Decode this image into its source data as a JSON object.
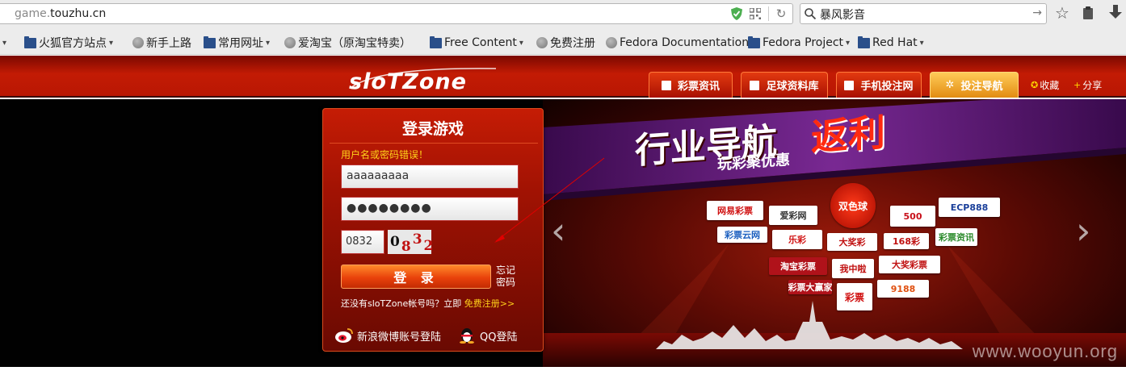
{
  "browser": {
    "url_prefix": "game.",
    "url_domain": "touzhu.cn",
    "search_value": "暴风影音"
  },
  "bookmarks": [
    {
      "label": "火狐官方站点",
      "type": "folder",
      "dropdown": true
    },
    {
      "label": "新手上路",
      "type": "globe",
      "dropdown": false
    },
    {
      "label": "常用网址",
      "type": "folder",
      "dropdown": true
    },
    {
      "label": "爱淘宝（原淘宝特卖）",
      "type": "globe",
      "dropdown": false
    },
    {
      "label": "Free Content",
      "type": "folder",
      "dropdown": true
    },
    {
      "label": "免费注册",
      "type": "globe",
      "dropdown": false
    },
    {
      "label": "Fedora Documentation",
      "type": "globe",
      "dropdown": false
    },
    {
      "label": "Fedora Project",
      "type": "folder",
      "dropdown": true
    },
    {
      "label": "Red Hat",
      "type": "folder",
      "dropdown": true
    }
  ],
  "header": {
    "logo": "sloTZone",
    "nav": [
      {
        "label": "彩票资讯",
        "icon": "list-icon",
        "active": false
      },
      {
        "label": "足球资料库",
        "icon": "doc-icon",
        "active": false
      },
      {
        "label": "手机投注网",
        "icon": "phone-icon",
        "active": false
      },
      {
        "label": "投注导航",
        "icon": "gear-icon",
        "active": true
      }
    ],
    "favorite": "收藏",
    "share": "分享"
  },
  "login": {
    "title": "登录游戏",
    "error": "用户名或密码错误！",
    "username": "aaaaaaaaa",
    "password": "●●●●●●●●",
    "captcha_input": "0832",
    "captcha_chars": [
      "0",
      "8",
      "3",
      "2"
    ],
    "captcha_colors": [
      "#111111",
      "#c01010",
      "#c01010",
      "#c01010"
    ],
    "submit": "登 录",
    "forgot": "忘记密码",
    "register_text": "还没有sloTZone帐号吗？立即",
    "register_link": "免费注册>>",
    "weibo": "新浪微博账号登陆",
    "qq": "QQ登陆"
  },
  "banner": {
    "headline": "行业导航",
    "headline_accent": "返利",
    "subline": "玩彩聚优惠",
    "partners": [
      {
        "label": "网易彩票",
        "color": "#d01010"
      },
      {
        "label": "爱彩网",
        "color": "#333333"
      },
      {
        "label": "双色球",
        "color": "#ffffff"
      },
      {
        "label": "500",
        "color": "#c8101a"
      },
      {
        "label": "ECP888",
        "color": "#1a3f9a"
      },
      {
        "label": "彩票云网",
        "color": "#1b5fbf"
      },
      {
        "label": "乐彩",
        "color": "#d01010"
      },
      {
        "label": "大奖彩",
        "color": "#c01010"
      },
      {
        "label": "168彩",
        "color": "#c01010"
      },
      {
        "label": "彩票资讯",
        "color": "#2a8a2a"
      },
      {
        "label": "淘宝彩票",
        "color": "#ffffff"
      },
      {
        "label": "我中啦",
        "color": "#c01010"
      },
      {
        "label": "大奖彩票",
        "color": "#c01010"
      },
      {
        "label": "彩票大赢家",
        "color": "#ffffff"
      },
      {
        "label": "彩票",
        "color": "#d01010"
      },
      {
        "label": "9188",
        "color": "#e05010"
      }
    ],
    "watermark": "www.wooyun.org"
  }
}
